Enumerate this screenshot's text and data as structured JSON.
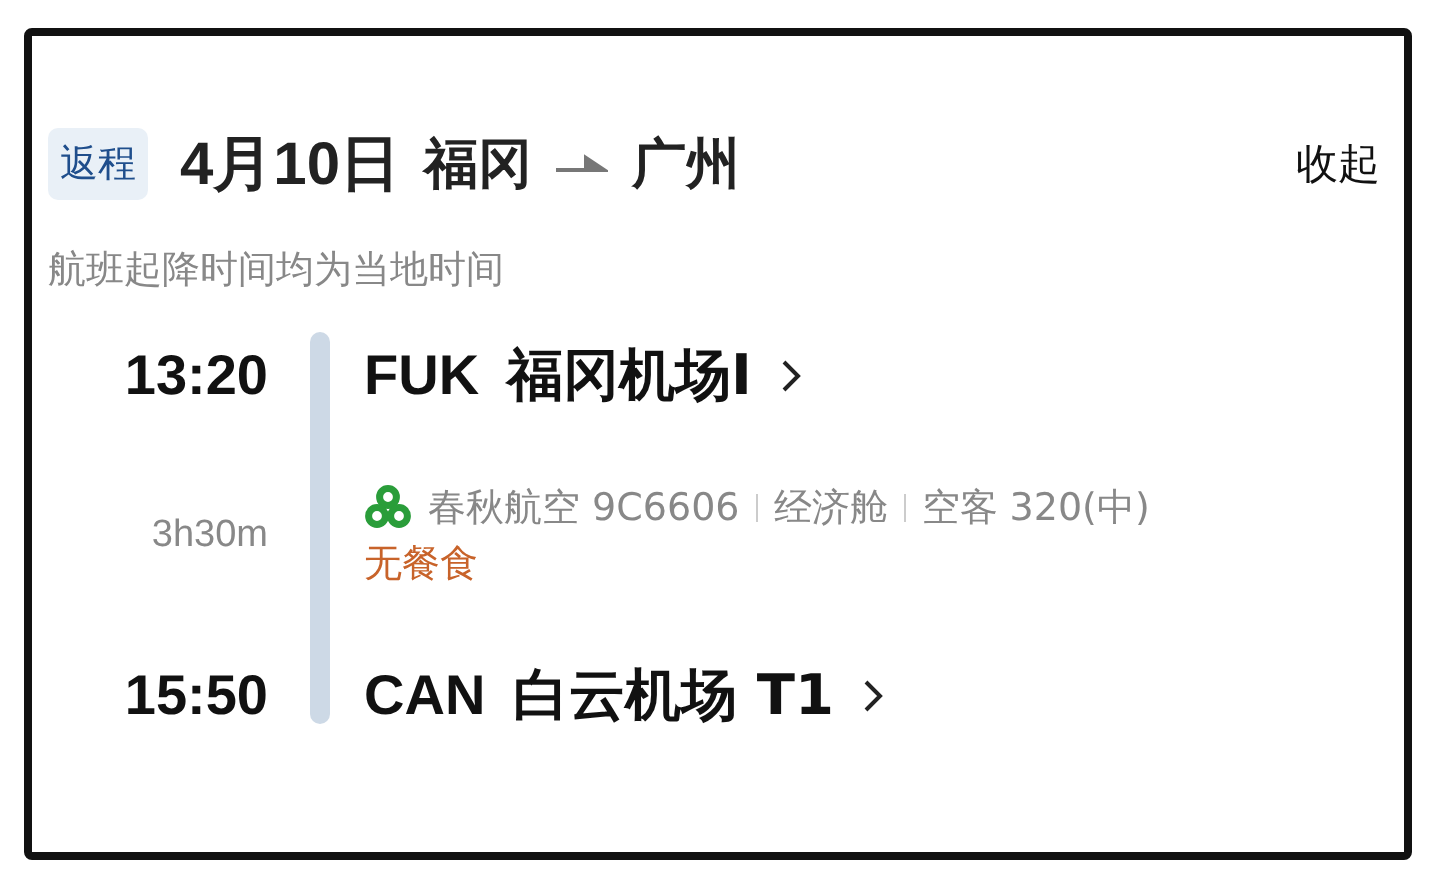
{
  "header": {
    "badge": "返程",
    "date": "4月10日",
    "from_city": "福冈",
    "to_city": "广州",
    "collapse": "收起"
  },
  "note": "航班起降时间均为当地时间",
  "departure": {
    "time": "13:20",
    "code": "FUK",
    "airport": "福冈机场I"
  },
  "duration": "3h30m",
  "flight_info": [
    "春秋航空 9C6606",
    "经济舱",
    "空客 320(中)"
  ],
  "meal": "无餐食",
  "arrival": {
    "time": "15:50",
    "code": "CAN",
    "airport": "白云机场 T1"
  }
}
